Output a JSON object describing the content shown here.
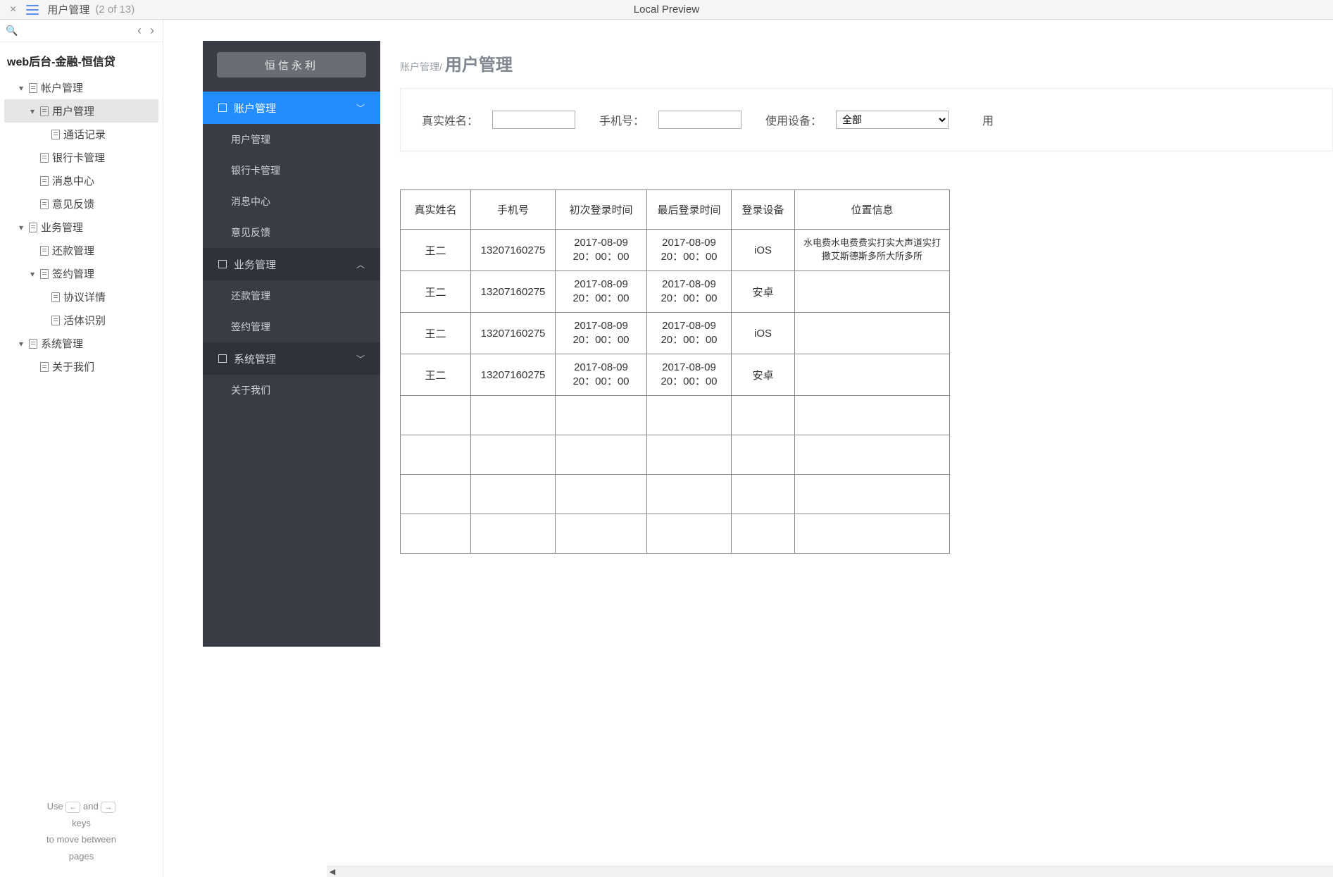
{
  "topbar": {
    "tab_title": "用户管理",
    "tab_count": "(2 of 13)",
    "center": "Local Preview"
  },
  "outline": {
    "root_title": "web后台-金融-恒信贷",
    "items": [
      {
        "label": "帐户管理",
        "level": 1,
        "caret": true
      },
      {
        "label": "用户管理",
        "level": 2,
        "caret": true,
        "selected": true
      },
      {
        "label": "通话记录",
        "level": 3,
        "caret": false
      },
      {
        "label": "银行卡管理",
        "level": 2,
        "caret": false
      },
      {
        "label": "消息中心",
        "level": 2,
        "caret": false
      },
      {
        "label": "意见反馈",
        "level": 2,
        "caret": false
      },
      {
        "label": "业务管理",
        "level": 1,
        "caret": true
      },
      {
        "label": "还款管理",
        "level": 2,
        "caret": false
      },
      {
        "label": "签约管理",
        "level": 2,
        "caret": true
      },
      {
        "label": "协议详情",
        "level": 3,
        "caret": false
      },
      {
        "label": "活体识别",
        "level": 3,
        "caret": false
      },
      {
        "label": "系统管理",
        "level": 1,
        "caret": true
      },
      {
        "label": "关于我们",
        "level": 2,
        "caret": false
      }
    ],
    "footer": {
      "use": "Use",
      "and": "and",
      "keys": "keys",
      "move": "to move between",
      "pages": "pages"
    }
  },
  "sidebar": {
    "brand": "恒信永利",
    "sections": [
      {
        "label": "账户管理",
        "state": "active",
        "chev": "﹀",
        "items": [
          "用户管理",
          "银行卡管理",
          "消息中心",
          "意见反馈"
        ]
      },
      {
        "label": "业务管理",
        "state": "darker",
        "chev": "︿",
        "items": [
          "还款管理",
          "签约管理"
        ]
      },
      {
        "label": "系统管理",
        "state": "darker",
        "chev": "﹀",
        "items": [
          "关于我们"
        ]
      }
    ]
  },
  "breadcrumb": {
    "small": "账户管理/",
    "big": "用户管理"
  },
  "filters": {
    "name_label": "真实姓名：",
    "phone_label": "手机号：",
    "device_label": "使用设备：",
    "device_option": "全部",
    "edge_label": "用"
  },
  "table": {
    "headers": [
      "真实姓名",
      "手机号",
      "初次登录时间",
      "最后登录时间",
      "登录设备",
      "位置信息"
    ],
    "rows": [
      {
        "name": "王二",
        "phone": "13207160275",
        "first": "2017-08-09  20：00：00",
        "last": "2017-08-09  20：00：00",
        "device": "iOS",
        "loc": "水电费水电费费实打实大声道实打撒艾斯德斯多所大所多所"
      },
      {
        "name": "王二",
        "phone": "13207160275",
        "first": "2017-08-09  20：00：00",
        "last": "2017-08-09  20：00：00",
        "device": "安卓",
        "loc": ""
      },
      {
        "name": "王二",
        "phone": "13207160275",
        "first": "2017-08-09  20：00：00",
        "last": "2017-08-09  20：00：00",
        "device": "iOS",
        "loc": ""
      },
      {
        "name": "王二",
        "phone": "13207160275",
        "first": "2017-08-09  20：00：00",
        "last": "2017-08-09  20：00：00",
        "device": "安卓",
        "loc": ""
      },
      {
        "name": "",
        "phone": "",
        "first": "",
        "last": "",
        "device": "",
        "loc": ""
      },
      {
        "name": "",
        "phone": "",
        "first": "",
        "last": "",
        "device": "",
        "loc": ""
      },
      {
        "name": "",
        "phone": "",
        "first": "",
        "last": "",
        "device": "",
        "loc": ""
      },
      {
        "name": "",
        "phone": "",
        "first": "",
        "last": "",
        "device": "",
        "loc": ""
      }
    ]
  }
}
